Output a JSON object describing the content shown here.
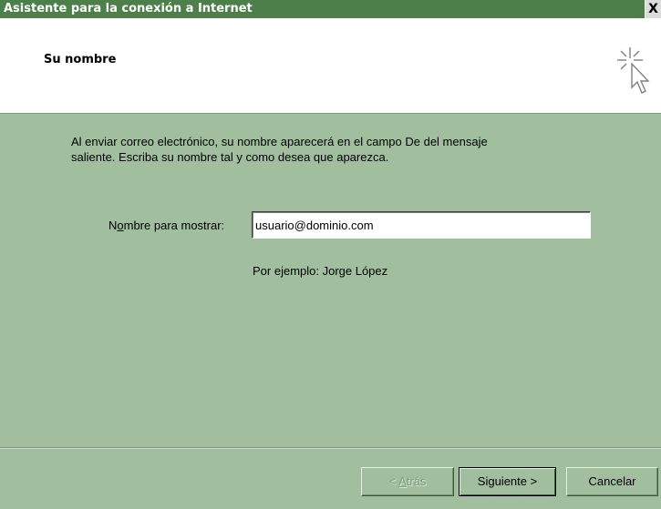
{
  "window": {
    "title": "Asistente para la conexión a Internet",
    "close_label": "X"
  },
  "header": {
    "title": "Su nombre",
    "icon": "wizard-cursor-icon"
  },
  "body": {
    "description_line1": "Al enviar correo electrónico, su nombre aparecerá en el campo De del mensaje",
    "description_line2": "saliente. Escriba su nombre tal y como desea que aparezca.",
    "field_label_pre": "N",
    "field_label_underlined": "o",
    "field_label_post": "mbre para mostrar:",
    "field_value": "usuario@dominio.com",
    "example": "Por ejemplo: Jorge López"
  },
  "footer": {
    "back_prefix": "< ",
    "back_underlined": "A",
    "back_rest": "trás",
    "next_label": "Siguiente >",
    "cancel_label": "Cancelar"
  },
  "colors": {
    "title_bar": "#4d7f4a",
    "dialog_bg": "#a1bf9f",
    "header_bg": "#ffffff"
  }
}
